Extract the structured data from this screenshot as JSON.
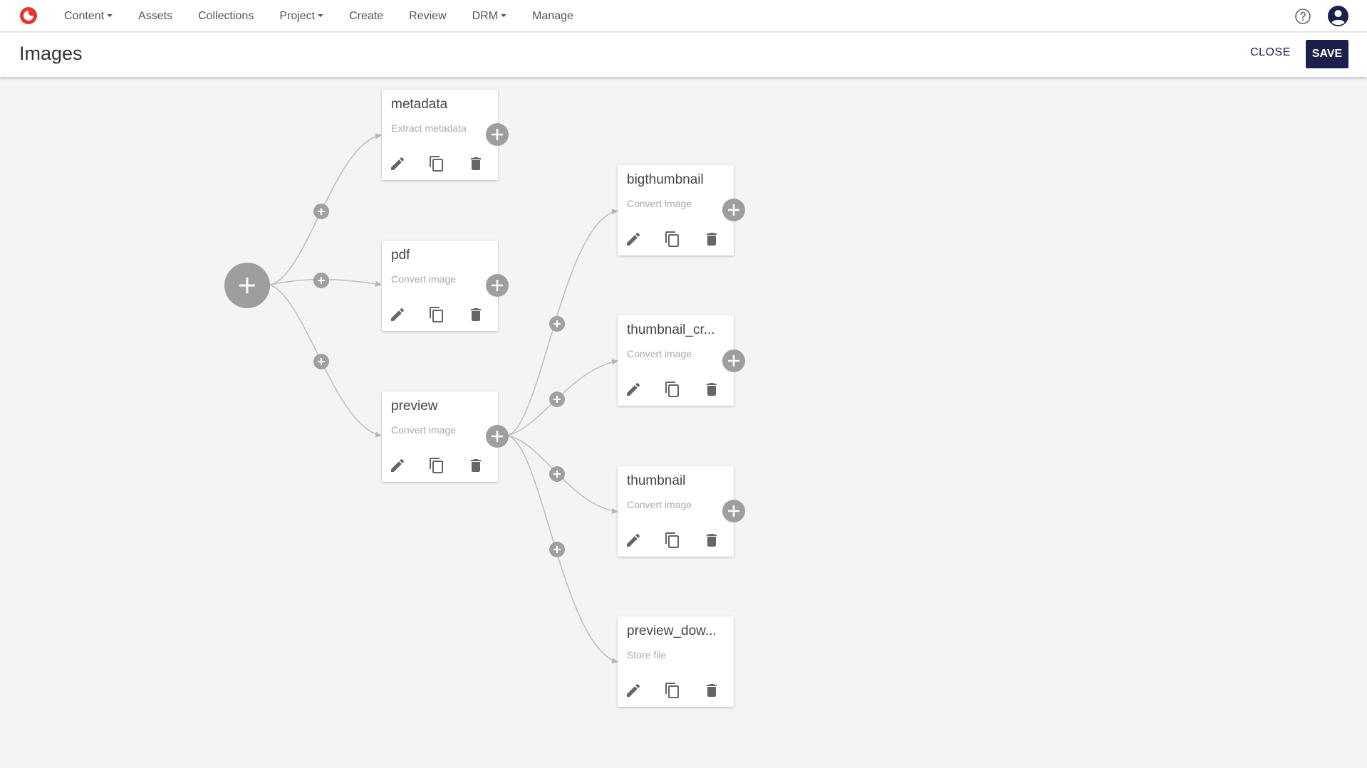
{
  "nav": {
    "items": [
      {
        "label": "Content",
        "dropdown": true
      },
      {
        "label": "Assets",
        "dropdown": false
      },
      {
        "label": "Collections",
        "dropdown": false
      },
      {
        "label": "Project",
        "dropdown": true
      },
      {
        "label": "Create",
        "dropdown": false
      },
      {
        "label": "Review",
        "dropdown": false
      },
      {
        "label": "DRM",
        "dropdown": true
      },
      {
        "label": "Manage",
        "dropdown": false
      }
    ],
    "icons": {
      "logo": "app-logo",
      "help": "help-icon",
      "user": "user-avatar-icon"
    }
  },
  "header": {
    "title": "Images",
    "close_label": "CLOSE",
    "save_label": "SAVE"
  },
  "nodes": [
    {
      "id": "metadata",
      "title": "metadata",
      "subtitle": "Extract metadata"
    },
    {
      "id": "pdf",
      "title": "pdf",
      "subtitle": "Convert image"
    },
    {
      "id": "preview",
      "title": "preview",
      "subtitle": "Convert image"
    },
    {
      "id": "bigthumbnail",
      "title": "bigthumbnail",
      "subtitle": "Convert image"
    },
    {
      "id": "thumbnail_crop",
      "title": "thumbnail_cr...",
      "subtitle": "Convert image"
    },
    {
      "id": "thumbnail",
      "title": "thumbnail",
      "subtitle": "Convert image"
    },
    {
      "id": "preview_download",
      "title": "preview_dow...",
      "subtitle": "Store file"
    }
  ],
  "edges": [
    {
      "from": "root",
      "to": "metadata"
    },
    {
      "from": "root",
      "to": "pdf"
    },
    {
      "from": "root",
      "to": "preview"
    },
    {
      "from": "preview",
      "to": "bigthumbnail"
    },
    {
      "from": "preview",
      "to": "thumbnail_crop"
    },
    {
      "from": "preview",
      "to": "thumbnail"
    },
    {
      "from": "preview",
      "to": "preview_download"
    }
  ],
  "colors": {
    "accent": "#1b1f4c",
    "node_plus": "#9e9e9e",
    "edge": "#b5b5b5",
    "logo": "#e8332a"
  }
}
